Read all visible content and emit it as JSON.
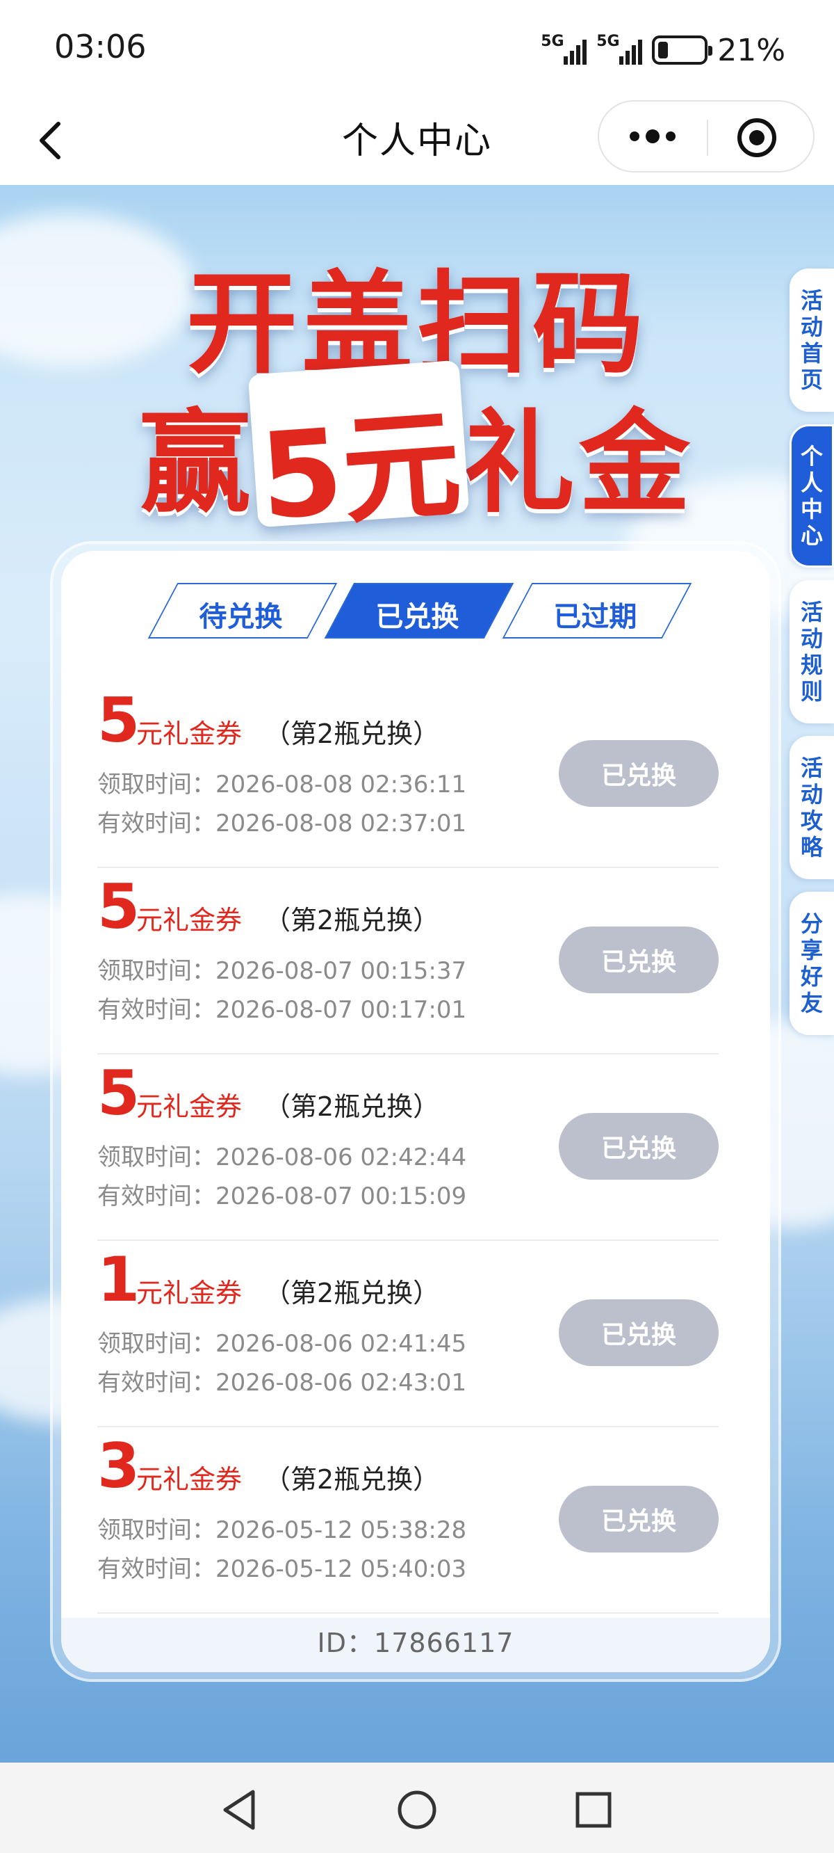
{
  "status_bar": {
    "time": "03:06",
    "signal1_label": "5G",
    "signal2_label": "5G",
    "battery": "21%"
  },
  "nav": {
    "title": "个人中心"
  },
  "banner": {
    "line1": "开盖扫码",
    "line2_prefix": "赢",
    "line2_amount": "5元",
    "line2_suffix": "礼金"
  },
  "side_tabs": [
    {
      "label": "活动首页",
      "active": false
    },
    {
      "label": "个人中心",
      "active": true
    },
    {
      "label": "活动规则",
      "active": false
    },
    {
      "label": "活动攻略",
      "active": false
    },
    {
      "label": "分享好友",
      "active": false
    }
  ],
  "tabs": [
    {
      "label": "待兑换",
      "active": false
    },
    {
      "label": "已兑换",
      "active": true
    },
    {
      "label": "已过期",
      "active": false
    }
  ],
  "coupons": [
    {
      "amount": "5",
      "unit": "元礼金券",
      "note": "（第2瓶兑换）",
      "receive_label": "领取时间：",
      "receive_time": "2026-08-08 02:36:11",
      "valid_label": "有效时间：",
      "valid_time": "2026-08-08 02:37:01",
      "status": "已兑换"
    },
    {
      "amount": "5",
      "unit": "元礼金券",
      "note": "（第2瓶兑换）",
      "receive_label": "领取时间：",
      "receive_time": "2026-08-07 00:15:37",
      "valid_label": "有效时间：",
      "valid_time": "2026-08-07 00:17:01",
      "status": "已兑换"
    },
    {
      "amount": "5",
      "unit": "元礼金券",
      "note": "（第2瓶兑换）",
      "receive_label": "领取时间：",
      "receive_time": "2026-08-06 02:42:44",
      "valid_label": "有效时间：",
      "valid_time": "2026-08-07 00:15:09",
      "status": "已兑换"
    },
    {
      "amount": "1",
      "unit": "元礼金券",
      "note": "（第2瓶兑换）",
      "receive_label": "领取时间：",
      "receive_time": "2026-08-06 02:41:45",
      "valid_label": "有效时间：",
      "valid_time": "2026-08-06 02:43:01",
      "status": "已兑换"
    },
    {
      "amount": "3",
      "unit": "元礼金券",
      "note": "（第2瓶兑换）",
      "receive_label": "领取时间：",
      "receive_time": "2026-05-12 05:38:28",
      "valid_label": "有效时间：",
      "valid_time": "2026-05-12 05:40:03",
      "status": "已兑换"
    }
  ],
  "footer": {
    "id_text": "ID：17866117"
  },
  "colors": {
    "brand_blue": "#1f5ed8",
    "accent_red": "#e0281e",
    "disabled_gray": "#bcc0cc"
  },
  "icons": {
    "back": "chevron-left-icon",
    "more": "more-dots-icon",
    "close": "target-close-icon",
    "nav_back": "triangle-back-icon",
    "nav_home": "circle-home-icon",
    "nav_recent": "square-recent-icon"
  }
}
